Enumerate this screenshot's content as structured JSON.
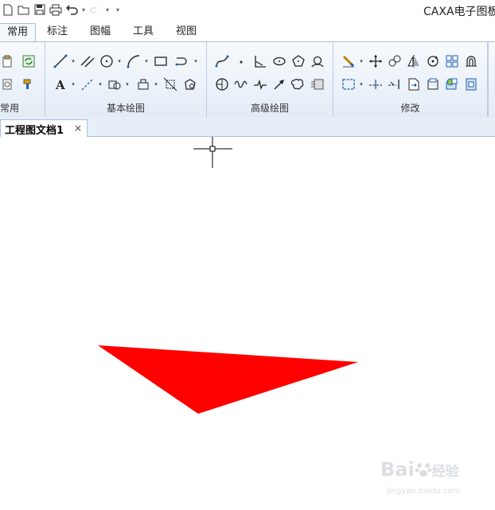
{
  "window": {
    "title": "CAXA电子图板"
  },
  "quick_access": {
    "icons": [
      "new-file-icon",
      "open-folder-icon",
      "save-icon",
      "print-icon",
      "undo-icon",
      "undo-dropdown-icon",
      "redo-icon",
      "redo-dropdown-icon",
      "customize-icon"
    ]
  },
  "ribbon_tabs": [
    {
      "label": "常用"
    },
    {
      "label": "标注"
    },
    {
      "label": "图幅"
    },
    {
      "label": "工具"
    },
    {
      "label": "视图"
    }
  ],
  "ribbon_groups": {
    "common": {
      "label": "常用"
    },
    "basic_draw": {
      "label": "基本绘图"
    },
    "advanced_draw": {
      "label": "高级绘图"
    },
    "modify": {
      "label": "修改"
    }
  },
  "document_tab": {
    "title": "工程图文档1",
    "close_glyph": "×"
  },
  "canvas": {
    "shape_color": "#ff0000",
    "cursor": "crosshair-cursor"
  },
  "watermark": {
    "brand": "Bai",
    "brand_cn": "经验",
    "url": "jingyan.baidu.com"
  },
  "colors": {
    "ribbon_border": "#a9c1dc",
    "accent_blue": "#1f5fb0",
    "shape_red": "#ff0000"
  }
}
